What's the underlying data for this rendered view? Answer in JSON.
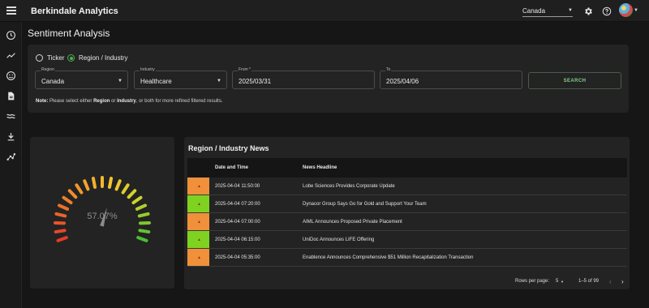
{
  "app": {
    "title": "Berkindale Analytics"
  },
  "header": {
    "country_value": "Canada",
    "icons": [
      "settings-icon",
      "help-icon",
      "avatar"
    ]
  },
  "sidebar": {
    "items": [
      {
        "icon": "clock-icon"
      },
      {
        "icon": "trend-line-icon"
      },
      {
        "icon": "smiley-icon"
      },
      {
        "icon": "document-icon"
      },
      {
        "icon": "waves-icon"
      },
      {
        "icon": "download-icon"
      },
      {
        "icon": "network-icon"
      }
    ]
  },
  "page": {
    "title": "Sentiment Analysis"
  },
  "filters": {
    "radio_ticker": "Ticker",
    "radio_region_industry": "Region / Industry",
    "selected": "region_industry",
    "region": {
      "label": "Region",
      "value": "Canada"
    },
    "industry": {
      "label": "Industry",
      "value": "Healthcare"
    },
    "from": {
      "label": "From *",
      "value": "2025/03/31"
    },
    "to": {
      "label": "To",
      "value": "2025/04/06"
    },
    "search_label": "SEARCH",
    "note_prefix": "Note:",
    "note_1": "Please select either",
    "note_region": "Region",
    "note_2": "or",
    "note_industry": "Industry",
    "note_3": ", or both for more refined filtered results."
  },
  "gauge": {
    "value_text": "57.07%",
    "value": 57.07
  },
  "news": {
    "title": "Region / Industry News",
    "columns": {
      "date": "Date and Time",
      "headline": "News Headline"
    },
    "rows": [
      {
        "sentiment_color": "#f0903a",
        "date": "2025-04-04 11:50:00",
        "headline": "Lobe Sciences Provides Corporate Update"
      },
      {
        "sentiment_color": "#7ed321",
        "date": "2025-04-04 07:20:00",
        "headline": "Dynacor Group Says Go for Gold and Support Your Team"
      },
      {
        "sentiment_color": "#f0903a",
        "date": "2025-04-04 07:00:00",
        "headline": "AIML Announces Proposed Private Placement"
      },
      {
        "sentiment_color": "#7ed321",
        "date": "2025-04-04 06:15:00",
        "headline": "UniDoc Announces LIFE Offering"
      },
      {
        "sentiment_color": "#f0903a",
        "date": "2025-04-04 05:35:00",
        "headline": "Enablence Announces Comprehensive $51 Million Recapitalization Transaction"
      }
    ],
    "pagination": {
      "rows_per_page_label": "Rows per page:",
      "rows_per_page": "5",
      "range": "1–5 of 99"
    }
  }
}
